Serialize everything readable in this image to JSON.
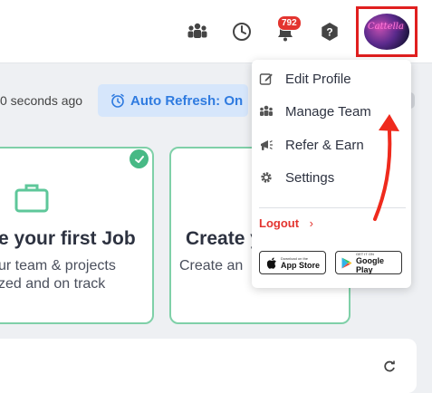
{
  "header": {
    "notification_count": "792",
    "avatar_text": "Cattella",
    "icons": [
      "team-icon",
      "clock-icon",
      "bell-icon",
      "help-icon"
    ]
  },
  "toolbar": {
    "refresh_text": "0 seconds ago",
    "auto_refresh_label": "Auto Refresh: On"
  },
  "cards": [
    {
      "title": "e your first Job",
      "desc_line1": "ur team & projects",
      "desc_line2": "zed and on track",
      "completed": true
    },
    {
      "title": "Create y",
      "desc_line1": "Create an",
      "desc_line2": ""
    }
  ],
  "menu": {
    "items": [
      {
        "label": "Edit Profile",
        "icon": "edit-icon"
      },
      {
        "label": "Manage Team",
        "icon": "team-icon"
      },
      {
        "label": "Refer & Earn",
        "icon": "megaphone-icon"
      },
      {
        "label": "Settings",
        "icon": "gear-icon"
      }
    ],
    "logout_label": "Logout",
    "app_store": {
      "small": "Download on the",
      "big": "App Store"
    },
    "google_play": {
      "small": "GET IT ON",
      "big": "Google Play"
    }
  },
  "colors": {
    "accent": "#2f7be0",
    "highlight": "#e01f1f",
    "card_border": "#7fd0a8",
    "logout": "#e3342f"
  }
}
